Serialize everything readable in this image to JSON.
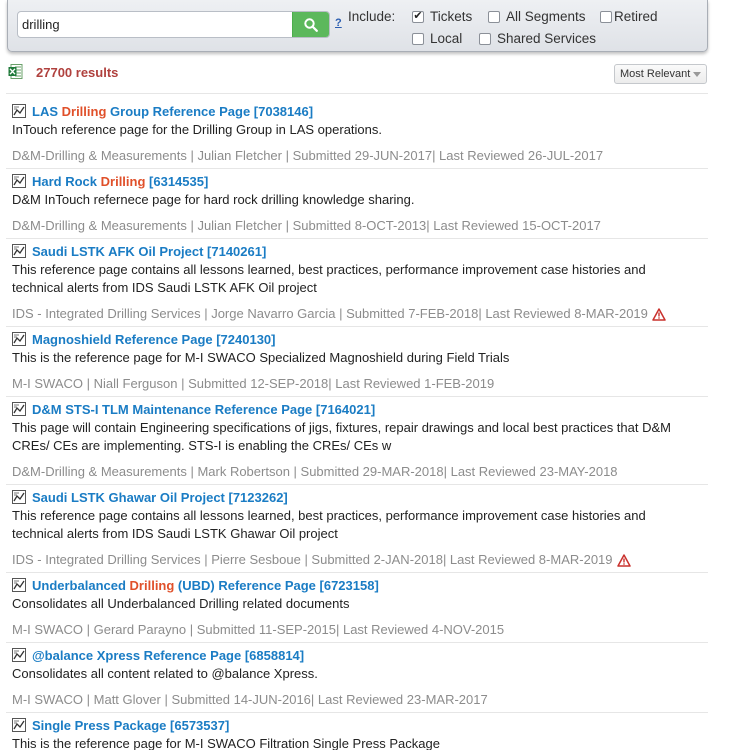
{
  "search": {
    "value": "drilling",
    "help": "?"
  },
  "include": {
    "label": "Include:",
    "options": [
      {
        "label": "Tickets",
        "checked": true
      },
      {
        "label": "All Segments",
        "checked": false
      },
      {
        "label": "Retired",
        "checked": false
      },
      {
        "label": "Local",
        "checked": false
      },
      {
        "label": "Shared Services",
        "checked": false
      }
    ]
  },
  "results_header": {
    "count": "27700 results",
    "sort": "Most Relevant"
  },
  "results": [
    {
      "pre": "LAS ",
      "hl": "Drilling",
      "post": " Group Reference Page [7038146]",
      "desc": "InTouch reference page for the Drilling Group in LAS operations.",
      "segment": "D&M-Drilling & Measurements ",
      "author": "| Julian Fletcher ",
      "submitted": "| Submitted 29-JUN-2017 ",
      "reviewed": "| Last Reviewed 26-JUL-2017",
      "warning": false
    },
    {
      "pre": "Hard Rock ",
      "hl": "Drilling",
      "post": " [6314535]",
      "desc": "D&M InTouch refernece page for hard rock drilling knowledge sharing.",
      "segment": "D&M-Drilling & Measurements ",
      "author": "| Julian Fletcher ",
      "submitted": "| Submitted 8-OCT-2013 ",
      "reviewed": "| Last Reviewed 15-OCT-2017",
      "warning": false
    },
    {
      "pre": "Saudi LSTK AFK Oil Project [7140261]",
      "hl": "",
      "post": "",
      "desc": "This reference page contains all lessons learned, best practices, performance improvement case histories and technical alerts from IDS Saudi LSTK AFK Oil project",
      "segment": "IDS - Integrated Drilling Services ",
      "author": "| Jorge Navarro Garcia ",
      "submitted": "| Submitted 7-FEB-2018 ",
      "reviewed": "| Last Reviewed 8-MAR-2019",
      "warning": true
    },
    {
      "pre": "Magnoshield Reference Page [7240130]",
      "hl": "",
      "post": "",
      "desc": "This is the reference page for M-I SWACO Specialized Magnoshield during Field Trials",
      "segment": "M-I SWACO ",
      "author": "| Niall Ferguson ",
      "submitted": "| Submitted 12-SEP-2018 ",
      "reviewed": "| Last Reviewed 1-FEB-2019",
      "warning": false
    },
    {
      "pre": "D&M STS-I TLM Maintenance Reference Page [7164021]",
      "hl": "",
      "post": "",
      "desc": "This page will contain Engineering specifications of jigs, fixtures, repair drawings and local best practices that D&M CREs/ CEs are implementing. STS-I is enabling the CREs/ CEs w",
      "segment": "D&M-Drilling & Measurements ",
      "author": "| Mark Robertson ",
      "submitted": "| Submitted 29-MAR-2018 ",
      "reviewed": "| Last Reviewed 23-MAY-2018",
      "warning": false
    },
    {
      "pre": "Saudi LSTK Ghawar Oil Project [7123262]",
      "hl": "",
      "post": "",
      "desc": "This reference page contains all lessons learned, best practices, performance improvement case histories and technical alerts from IDS Saudi LSTK Ghawar Oil project",
      "segment": "IDS - Integrated Drilling Services ",
      "author": "| Pierre Sesboue ",
      "submitted": "| Submitted 2-JAN-2018 ",
      "reviewed": "| Last Reviewed 8-MAR-2019",
      "warning": true
    },
    {
      "pre": "Underbalanced ",
      "hl": "Drilling",
      "post": " (UBD) Reference Page [6723158]",
      "desc": "Consolidates all Underbalanced Drilling related documents",
      "segment": "M-I SWACO ",
      "author": "| Gerard Parayno ",
      "submitted": "| Submitted 11-SEP-2015 ",
      "reviewed": "| Last Reviewed 4-NOV-2015",
      "warning": false
    },
    {
      "pre": "@balance Xpress Reference Page [6858814]",
      "hl": "",
      "post": "",
      "desc": "Consolidates all content related to @balance Xpress.",
      "segment": "M-I SWACO ",
      "author": "| Matt Glover ",
      "submitted": "| Submitted 14-JUN-2016 ",
      "reviewed": "| Last Reviewed 23-MAR-2017",
      "warning": false
    },
    {
      "pre": "Single Press Package [6573537]",
      "hl": "",
      "post": "",
      "desc": "This is the reference page for M-I SWACO Filtration Single Press Package",
      "segment": "",
      "author": "",
      "submitted": "",
      "reviewed": "",
      "warning": false
    }
  ]
}
